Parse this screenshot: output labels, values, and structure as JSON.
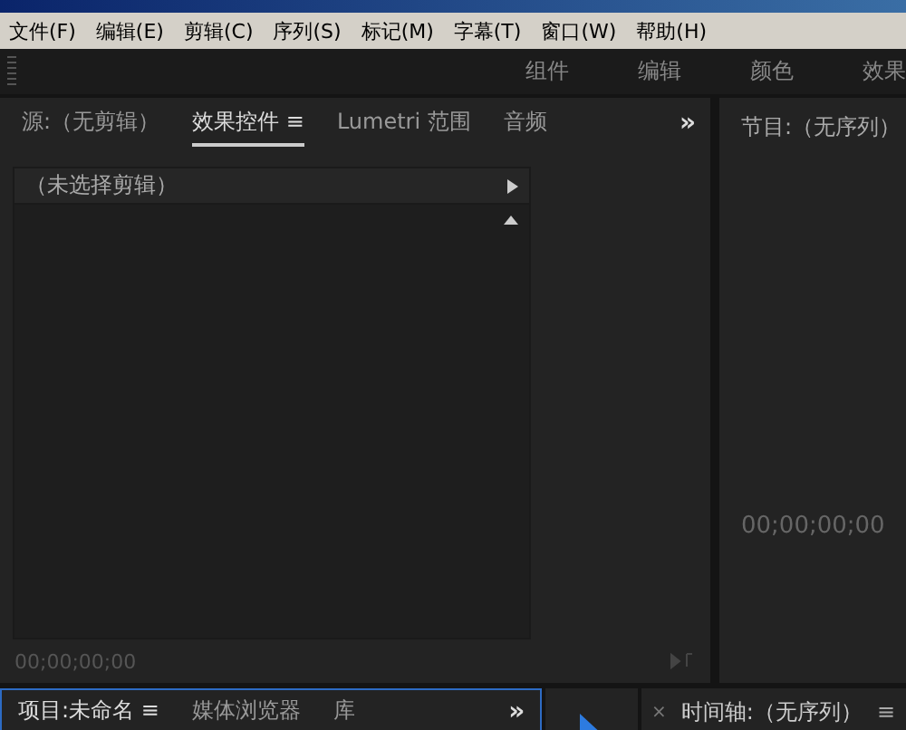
{
  "menu_bar": {
    "items": [
      "文件(F)",
      "编辑(E)",
      "剪辑(C)",
      "序列(S)",
      "标记(M)",
      "字幕(T)",
      "窗口(W)",
      "帮助(H)"
    ]
  },
  "workspaces": {
    "items": [
      {
        "label": "组件",
        "selected": false
      },
      {
        "label": "编辑",
        "selected": false
      },
      {
        "label": "颜色",
        "selected": false
      },
      {
        "label": "效果",
        "selected": false
      }
    ]
  },
  "source_panel": {
    "tabs": [
      {
        "label": "源:（无剪辑）",
        "selected": false
      },
      {
        "label": "效果控件",
        "selected": true,
        "menu": "≡"
      },
      {
        "label": "Lumetri 范围",
        "selected": false
      },
      {
        "label": "音频",
        "selected": false
      }
    ],
    "overflow": "»",
    "clip_header": "（未选择剪辑）",
    "timecode": "00;00;00;00"
  },
  "program_panel": {
    "title": "节目:（无序列）",
    "timecode": "00;00;00;00"
  },
  "project_panel": {
    "tabs": [
      {
        "label": "项目:未命名",
        "selected": true,
        "menu": "≡"
      },
      {
        "label": "媒体浏览器",
        "selected": false
      },
      {
        "label": "库",
        "selected": false
      }
    ],
    "overflow": "»"
  },
  "timeline_panel": {
    "close": "×",
    "title": "时间轴:（无序列）",
    "menu": "≡"
  }
}
